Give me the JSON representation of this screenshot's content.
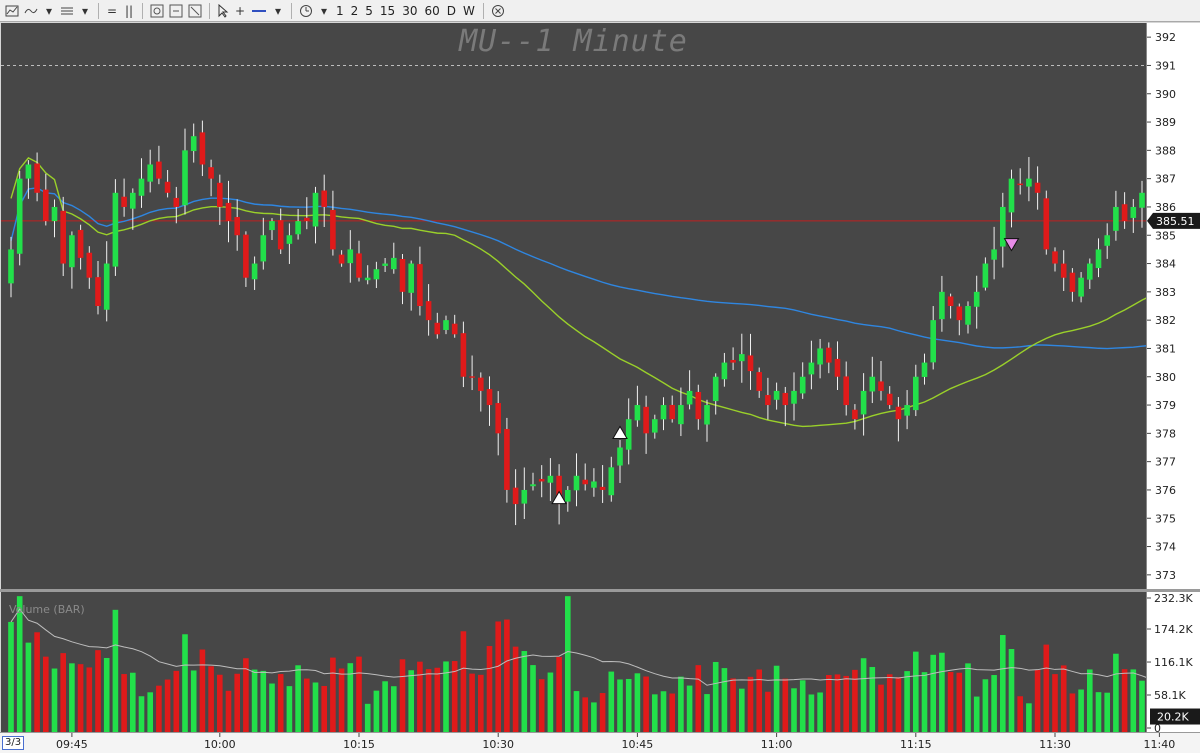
{
  "toolbar": {
    "tools": [
      {
        "name": "chart-type-icon",
        "glyph": "📈"
      },
      {
        "name": "line-style-icon",
        "glyph": "≈"
      },
      {
        "name": "indicator-menu-icon",
        "glyph": "≡"
      }
    ],
    "timeframes": [
      "1",
      "2",
      "5",
      "15",
      "30",
      "60",
      "D",
      "W"
    ]
  },
  "chart_title": "MU--1 Minute",
  "volume_title": "Volume (BAR)",
  "page_indicator": "3/3",
  "colors": {
    "pane_bg": "#474747",
    "up": "#22e04a",
    "down": "#e01a1a",
    "ma_fast": "#2f86e0",
    "ma_slow": "#9ad02a",
    "price_line": "#c02020",
    "volume_avg": "#bdbdbd"
  },
  "last_price_label": "385.51",
  "volume_last_label": "20.2K",
  "chart_data": {
    "type": "candlestick",
    "symbol": "MU",
    "interval": "1 Minute",
    "price_axis": {
      "ticks": [
        373,
        374,
        375,
        376,
        377,
        378,
        379,
        380,
        381,
        382,
        383,
        384,
        385,
        386,
        387,
        388,
        389,
        390,
        391,
        392
      ],
      "range": [
        372.5,
        392.5
      ]
    },
    "volume_axis": {
      "ticks": [
        "232.3K",
        "174.2K",
        "116.1K",
        "58.1K",
        "0"
      ],
      "range": [
        0,
        232300
      ]
    },
    "time_axis": {
      "labels": [
        "09:45",
        "10:00",
        "10:15",
        "10:30",
        "10:45",
        "11:00",
        "11:15",
        "11:30",
        "11:40"
      ]
    },
    "last_price": 385.51,
    "dashed_level": 391,
    "markers": [
      {
        "type": "buy",
        "bar": 63,
        "price": 375.8
      },
      {
        "type": "buy",
        "bar": 70,
        "price": 378.1
      },
      {
        "type": "sell",
        "bar": 115,
        "price": 384.6
      }
    ],
    "close": [
      384.5,
      387.0,
      387.5,
      386.5,
      385.5,
      386.0,
      384.0,
      385.0,
      384.2,
      383.5,
      382.5,
      384.0,
      386.5,
      386.0,
      386.5,
      387.0,
      387.5,
      387.0,
      386.5,
      386.0,
      388.0,
      388.5,
      387.5,
      387.0,
      386.0,
      385.5,
      385.0,
      383.5,
      384.0,
      385.0,
      385.5,
      384.5,
      385.0,
      385.5,
      385.5,
      386.5,
      386.0,
      384.5,
      384.0,
      384.5,
      383.5,
      383.5,
      383.8,
      384.0,
      384.2,
      383.0,
      384.0,
      382.5,
      382.0,
      381.5,
      382.0,
      381.5,
      380.0,
      380.0,
      379.5,
      379.0,
      378.0,
      376.0,
      375.5,
      376.0,
      376.2,
      376.3,
      376.5,
      375.5,
      376.0,
      376.5,
      376.2,
      376.3,
      376.0,
      376.8,
      377.5,
      378.5,
      379.0,
      378.0,
      378.5,
      379.0,
      378.5,
      379.0,
      379.5,
      378.5,
      379.0,
      380.0,
      380.5,
      380.5,
      380.8,
      380.2,
      379.5,
      379.0,
      379.5,
      379.0,
      379.5,
      380.0,
      380.5,
      381.0,
      380.5,
      380.0,
      379.0,
      378.5,
      379.5,
      380.0,
      379.5,
      379.0,
      378.5,
      379.0,
      380.0,
      380.5,
      382.0,
      383.0,
      382.5,
      382.0,
      382.5,
      383.0,
      384.0,
      384.5,
      386.0,
      387.0,
      386.8,
      387.0,
      386.5,
      384.5,
      384.0,
      383.5,
      383.0,
      383.5,
      384.0,
      384.5,
      385.0,
      386.0,
      385.5,
      386.0,
      386.5,
      386.0,
      385.0,
      385.0,
      384.5,
      385.0,
      385.5,
      385.5,
      386.0,
      386.5,
      386.0,
      385.5,
      384.8,
      385.2,
      385.0,
      384.5,
      384.2,
      384.0,
      383.5,
      384.5,
      385.0,
      386.0,
      385.5,
      385.0,
      385.0,
      386.0,
      385.5
    ]
  }
}
